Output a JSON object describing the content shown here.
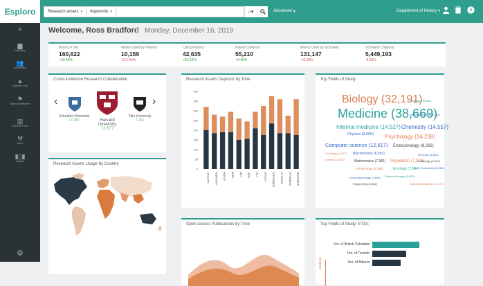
{
  "topbar": {
    "logo": "Esploro",
    "search_scope": "Research assets",
    "search_field": "Keywords",
    "advanced": "Advanced",
    "department": "Department of History"
  },
  "sidebar": {
    "items": [
      {
        "label": "",
        "icon": "menu-icon"
      },
      {
        "label": "Repository",
        "icon": "document-icon"
      },
      {
        "label": "Researchers",
        "icon": "people-icon"
      },
      {
        "label": "Academic Units",
        "icon": "graduation-icon"
      },
      {
        "label": "National Assessment",
        "icon": "flag-icon"
      },
      {
        "label": "Research Portal",
        "icon": "building-icon"
      },
      {
        "label": "Admin",
        "icon": "wrench-icon"
      },
      {
        "label": "Analytics",
        "icon": "analytics-icon"
      },
      {
        "label": "",
        "icon": "gear-icon"
      }
    ]
  },
  "welcome": "Welcome, Ross Bradford",
  "date": "Monday, December 16, 2019",
  "stats": [
    {
      "label": "Works in Set",
      "value": "160,622",
      "change": "+33.45%",
      "color": "#3a9a3a"
    },
    {
      "label": "Works Cited by Patents",
      "value": "10,159",
      "change": "-113.45%",
      "color": "#d9534f"
    },
    {
      "label": "Citing Patents",
      "value": "42,635",
      "change": "+62.52%",
      "color": "#3a9a3a"
    },
    {
      "label": "Patent Citations",
      "value": "55,210",
      "change": "+4.46%",
      "color": "#3a9a3a"
    },
    {
      "label": "Works Cited by Scholarly",
      "value": "131,147",
      "change": "-10.28%",
      "color": "#d9534f"
    },
    {
      "label": "Scholarly Citations",
      "value": "5,449,193",
      "change": "-8.29%",
      "color": "#d9534f"
    }
  ],
  "collab": {
    "title": "Cross-institution Research Collaboration",
    "universities": [
      {
        "name": "Columbia University",
        "count": "17,080"
      },
      {
        "name": "Harvard University",
        "count": "12,677"
      },
      {
        "name": "Yale University",
        "count": "7,261"
      }
    ]
  },
  "usage_map": {
    "title": "Research Assets Usage by Country"
  },
  "deposits": {
    "title": "Research Assets Deposits by Time"
  },
  "top_fields": {
    "title": "Top Fields of Study",
    "words": [
      {
        "t": "Biology (32,191)",
        "c": "#e07b53"
      },
      {
        "t": "Medicine (38,669)",
        "c": "#2aa198"
      },
      {
        "t": "Internal medicine (14,527)",
        "c": "#2aa198"
      },
      {
        "t": "Chemistry (14,557)",
        "c": "#3366cc"
      },
      {
        "t": "Physics (9,666)",
        "c": "#3366cc"
      },
      {
        "t": "Psychology (14,238)",
        "c": "#e07b53"
      },
      {
        "t": "Computer science (12,617)",
        "c": "#3366cc"
      },
      {
        "t": "Endocrinology (8,262)",
        "c": "#444444"
      },
      {
        "t": "Biochemistry (8,961)",
        "c": "#3366cc"
      },
      {
        "t": "Population (7,070)",
        "c": "#e07b53"
      },
      {
        "t": "Mathematics (7,981)",
        "c": "#444444"
      },
      {
        "t": "Ecology (7,044)",
        "c": "#2aa198"
      },
      {
        "t": "Immunology (6,386)",
        "c": "#e07b53"
      },
      {
        "t": "Genetics (5,844)",
        "c": "#3366cc"
      },
      {
        "t": "Pathology (5,314)",
        "c": "#444444"
      },
      {
        "t": "Sociology (4,977)",
        "c": "#e07b53"
      },
      {
        "t": "Surgery (4,643)",
        "c": "#e07b53"
      },
      {
        "t": "Economics (5,060)",
        "c": "#3366cc"
      },
      {
        "t": "Diabetes mellitus (6,267)",
        "c": "#3366cc"
      },
      {
        "t": "Sociology (5,385)",
        "c": "#2aa198"
      },
      {
        "t": "Physical therapy (4,000)",
        "c": "#2aa198"
      },
      {
        "t": "Social psychology (3,643)",
        "c": "#3366cc"
      },
      {
        "t": "Engineering (4,552)",
        "c": "#444444"
      },
      {
        "t": "Artificial intelligence (4,474)",
        "c": "#e07b53"
      }
    ]
  },
  "open_access": {
    "title": "Open Access Publications by Time"
  },
  "etds": {
    "title": "Top Fields of Study- ETDs",
    "axis_label": "Medicine",
    "bars": [
      {
        "label": "Uni. of British Columbia",
        "value": 100
      },
      {
        "label": "Uni. of Toronto",
        "value": 72
      },
      {
        "label": "Uni. of Alberta",
        "value": 60
      }
    ]
  },
  "chart_data": {
    "type": "bar",
    "title": "Research Assets Deposits by Time",
    "categories": [
      "JANUARY",
      "FEBRUARY",
      "MARCH",
      "APRIL",
      "MAY",
      "JUNE",
      "JULY",
      "AUGUST",
      "SEPTEMBER",
      "OCTOBER",
      "NOVEMBER",
      "DECEMBER"
    ],
    "ylim": [
      0,
      400
    ],
    "yticks": [
      0,
      50,
      100,
      150,
      200,
      250,
      300,
      350,
      400
    ],
    "series": [
      {
        "values": [
          200,
          185,
          190,
          190,
          150,
          155,
          210,
          175,
          235,
          185,
          185,
          175
        ],
        "color": "#263743"
      },
      {
        "values": [
          120,
          95,
          80,
          105,
          110,
          90,
          85,
          150,
          140,
          175,
          90,
          185
        ],
        "color": "#de8d5c"
      }
    ]
  }
}
